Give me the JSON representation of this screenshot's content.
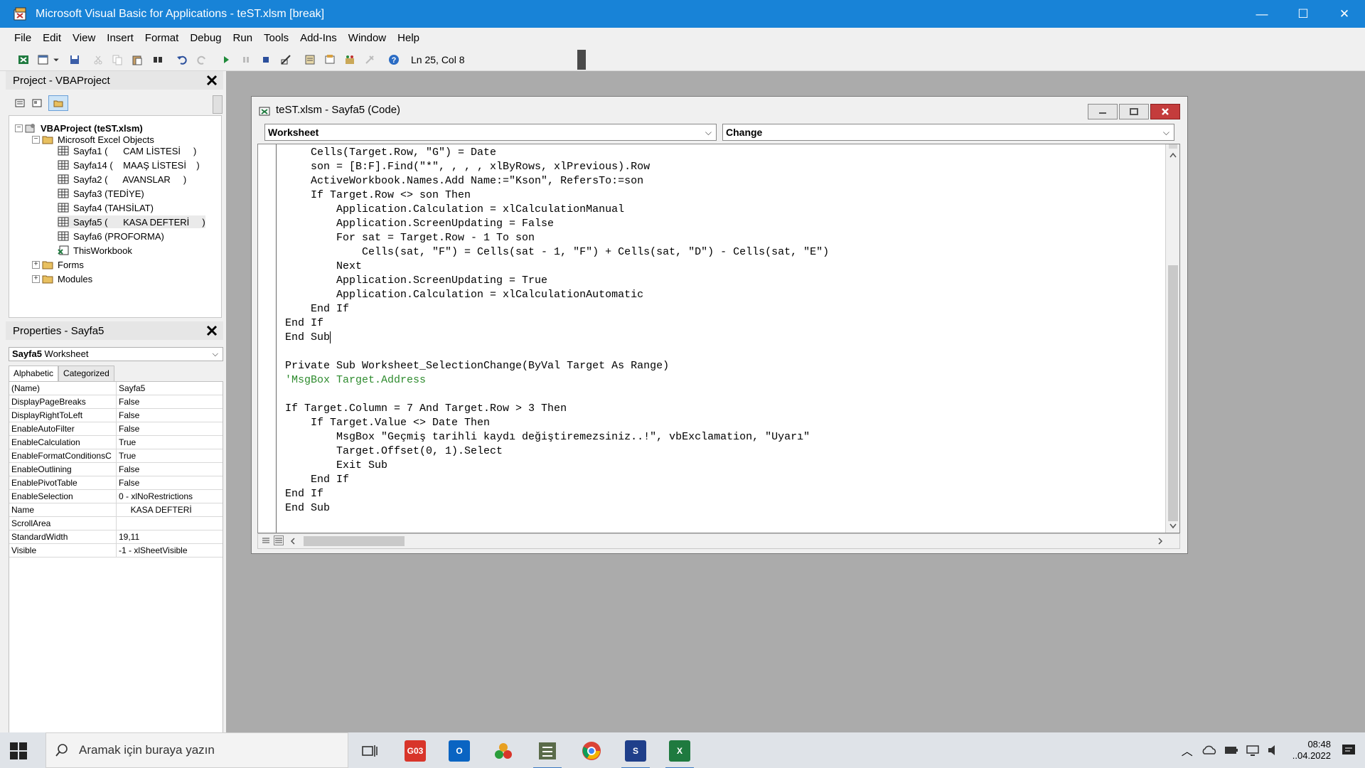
{
  "window": {
    "title": "Microsoft Visual Basic for Applications - teST.xlsm [break]",
    "controls": {
      "minimize": "—",
      "maximize": "☐",
      "close": "✕"
    }
  },
  "menu": [
    "File",
    "Edit",
    "View",
    "Insert",
    "Format",
    "Debug",
    "Run",
    "Tools",
    "Add-Ins",
    "Window",
    "Help"
  ],
  "toolbar": {
    "position_label": "Ln 25, Col 8",
    "icons": [
      "view-excel-icon",
      "insert-module-icon",
      "save-icon",
      "cut-icon",
      "copy-icon",
      "paste-icon",
      "find-icon",
      "undo-icon",
      "redo-icon",
      "run-icon",
      "break-icon",
      "reset-icon",
      "design-mode-icon",
      "project-explorer-icon",
      "properties-window-icon",
      "object-browser-icon",
      "toolbox-icon",
      "help-icon"
    ]
  },
  "project": {
    "title": "Project - VBAProject",
    "root": "VBAProject (teST.xlsm)",
    "excel_objects_label": "Microsoft Excel Objects",
    "sheets": [
      "Sayfa1 (      CAM LİSTESİ     )",
      "Sayfa14 (    MAAŞ LİSTESİ    )",
      "Sayfa2 (      AVANSLAR     )",
      "Sayfa3 (TEDİYE)",
      "Sayfa4 (TAHSİLAT)",
      "Sayfa5 (      KASA DEFTERİ     )",
      "Sayfa6 (PROFORMA)",
      "ThisWorkbook"
    ],
    "forms_label": "Forms",
    "modules_label": "Modules",
    "close": "✕"
  },
  "properties": {
    "title": "Properties - Sayfa5",
    "object_name": "Sayfa5",
    "object_type": "Worksheet",
    "tabs": [
      "Alphabetic",
      "Categorized"
    ],
    "rows": [
      {
        "name": "(Name)",
        "value": "Sayfa5"
      },
      {
        "name": "DisplayPageBreaks",
        "value": "False"
      },
      {
        "name": "DisplayRightToLeft",
        "value": "False"
      },
      {
        "name": "EnableAutoFilter",
        "value": "False"
      },
      {
        "name": "EnableCalculation",
        "value": "True"
      },
      {
        "name": "EnableFormatConditionsC",
        "value": "True"
      },
      {
        "name": "EnableOutlining",
        "value": "False"
      },
      {
        "name": "EnablePivotTable",
        "value": "False"
      },
      {
        "name": "EnableSelection",
        "value": "0 - xlNoRestrictions"
      },
      {
        "name": "Name",
        "value": "     KASA DEFTERİ"
      },
      {
        "name": "ScrollArea",
        "value": ""
      },
      {
        "name": "StandardWidth",
        "value": "19,11"
      },
      {
        "name": "Visible",
        "value": "-1 - xlSheetVisible"
      }
    ],
    "close": "✕"
  },
  "code_window": {
    "title": "teST.xlsm - Sayfa5 (Code)",
    "object_combo": "Worksheet",
    "procedure_combo": "Change",
    "lines": [
      {
        "text": "    Cells(Target.Row, \"G\") = Date",
        "type": "code"
      },
      {
        "text": "    son = [B:F].Find(\"*\", , , , xlByRows, xlPrevious).Row",
        "type": "code"
      },
      {
        "text": "    ActiveWorkbook.Names.Add Name:=\"Kson\", RefersTo:=son",
        "type": "code"
      },
      {
        "text": "    If Target.Row <> son Then",
        "type": "code"
      },
      {
        "text": "        Application.Calculation = xlCalculationManual",
        "type": "code"
      },
      {
        "text": "        Application.ScreenUpdating = False",
        "type": "code"
      },
      {
        "text": "        For sat = Target.Row - 1 To son",
        "type": "code"
      },
      {
        "text": "            Cells(sat, \"F\") = Cells(sat - 1, \"F\") + Cells(sat, \"D\") - Cells(sat, \"E\")",
        "type": "code"
      },
      {
        "text": "        Next",
        "type": "code"
      },
      {
        "text": "        Application.ScreenUpdating = True",
        "type": "code"
      },
      {
        "text": "        Application.Calculation = xlCalculationAutomatic",
        "type": "code"
      },
      {
        "text": "    End If",
        "type": "code"
      },
      {
        "text": "End If",
        "type": "code"
      },
      {
        "text": "End Sub",
        "type": "code",
        "caret": true
      },
      {
        "text": "",
        "type": "code"
      },
      {
        "text": "Private Sub Worksheet_SelectionChange(ByVal Target As Range)",
        "type": "code"
      },
      {
        "text": "'MsgBox Target.Address",
        "type": "comment"
      },
      {
        "text": "",
        "type": "code"
      },
      {
        "text": "If Target.Column = 7 And Target.Row > 3 Then",
        "type": "code"
      },
      {
        "text": "    If Target.Value <> Date Then",
        "type": "code"
      },
      {
        "text": "        MsgBox \"Geçmiş tarihli kaydı değiştiremezsiniz..!\", vbExclamation, \"Uyarı\"",
        "type": "code"
      },
      {
        "text": "        Target.Offset(0, 1).Select",
        "type": "code"
      },
      {
        "text": "        Exit Sub",
        "type": "code"
      },
      {
        "text": "    End If",
        "type": "code"
      },
      {
        "text": "End If",
        "type": "code"
      },
      {
        "text": "End Sub",
        "type": "code"
      }
    ]
  },
  "taskbar": {
    "search_placeholder": "Aramak için buraya yazın",
    "apps": [
      {
        "name": "task-view",
        "label": ""
      },
      {
        "name": "app-red",
        "label": "G03"
      },
      {
        "name": "outlook",
        "label": "O"
      },
      {
        "name": "app-balls",
        "label": ""
      },
      {
        "name": "app-calc",
        "label": ""
      },
      {
        "name": "chrome",
        "label": ""
      },
      {
        "name": "app-s",
        "label": "S"
      },
      {
        "name": "excel",
        "label": "X"
      }
    ],
    "clock_time": "08:48",
    "clock_date": "..04.2022"
  },
  "colors": {
    "titlebar": "#1883d7",
    "comment": "#2e8b2e",
    "mdi_background": "#ababab"
  }
}
